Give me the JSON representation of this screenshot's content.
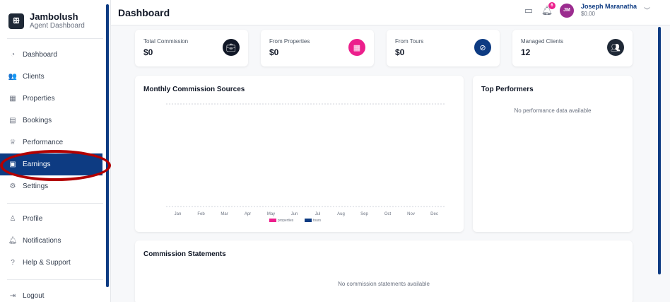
{
  "sidebar": {
    "brand_name": "Jambolush",
    "brand_sub": "Agent Dashboard",
    "items": [
      {
        "label": "Dashboard",
        "icon": "dashboard-icon"
      },
      {
        "label": "Clients",
        "icon": "users-icon"
      },
      {
        "label": "Properties",
        "icon": "building-icon"
      },
      {
        "label": "Bookings",
        "icon": "calendar-icon"
      },
      {
        "label": "Performance",
        "icon": "trophy-icon"
      },
      {
        "label": "Earnings",
        "icon": "wallet-icon",
        "active": true
      },
      {
        "label": "Settings",
        "icon": "gear-icon"
      }
    ],
    "secondary": [
      {
        "label": "Profile",
        "icon": "person-icon"
      },
      {
        "label": "Notifications",
        "icon": "bell-icon"
      },
      {
        "label": "Help & Support",
        "icon": "help-icon"
      }
    ],
    "logout": "Logout"
  },
  "header": {
    "title": "Dashboard",
    "notif_count": "6",
    "avatar_initials": "JM",
    "user_name": "Joseph Maranatha",
    "user_balance": "$0.00"
  },
  "stats": [
    {
      "label": "Total Commission",
      "value": "$0",
      "icon": "briefcase-icon",
      "color": "#111827"
    },
    {
      "label": "From Properties",
      "value": "$0",
      "icon": "building-icon",
      "color": "#ec1f8c"
    },
    {
      "label": "From Tours",
      "value": "$0",
      "icon": "compass-icon",
      "color": "#0d3b82"
    },
    {
      "label": "Managed Clients",
      "value": "12",
      "icon": "users-icon",
      "color": "#1f2937"
    }
  ],
  "monthly": {
    "title": "Monthly Commission Sources"
  },
  "chart_data": {
    "type": "bar",
    "categories": [
      "Jan",
      "Feb",
      "Mar",
      "Apr",
      "May",
      "Jun",
      "Jul",
      "Aug",
      "Sep",
      "Oct",
      "Nov",
      "Dec"
    ],
    "series": [
      {
        "name": "properties",
        "color": "#ec1f8c",
        "values": [
          0,
          0,
          0,
          0,
          0,
          0,
          0,
          0,
          0,
          0,
          0,
          0
        ]
      },
      {
        "name": "tours",
        "color": "#0d3b82",
        "values": [
          0,
          0,
          0,
          0,
          0,
          0,
          0,
          0,
          0,
          0,
          0,
          0
        ]
      }
    ],
    "legend": "bottom"
  },
  "top_performers": {
    "title": "Top Performers",
    "empty": "No performance data available"
  },
  "statements": {
    "title": "Commission Statements",
    "empty": "No commission statements available"
  }
}
